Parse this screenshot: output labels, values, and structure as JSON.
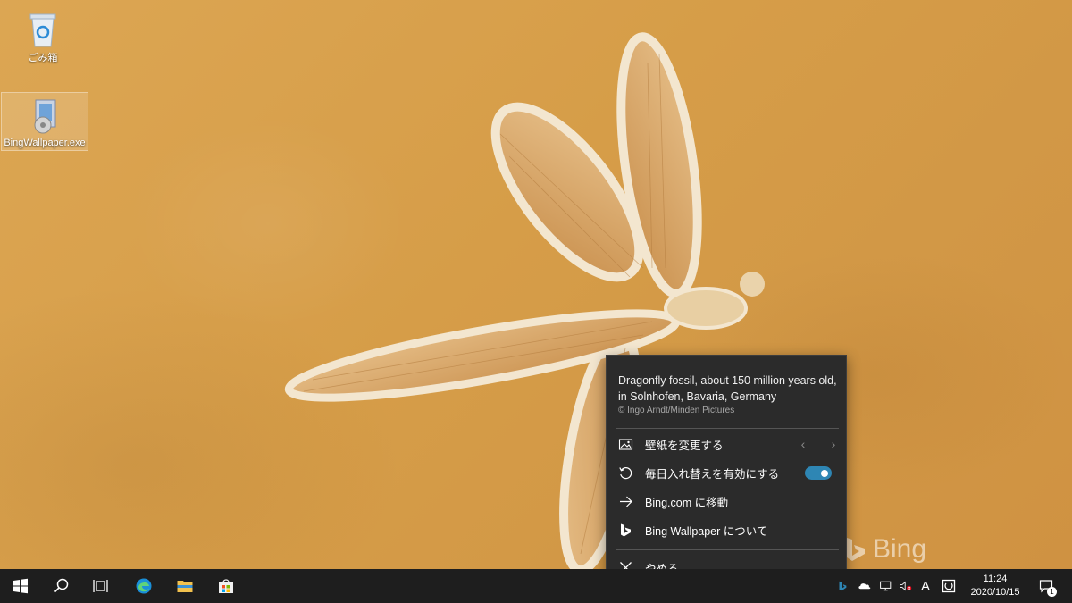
{
  "desktop": {
    "icons": [
      {
        "label": "ごみ箱",
        "icon": "recycle-bin-icon"
      },
      {
        "label": "BingWallpaper.exe",
        "icon": "installer-icon"
      }
    ]
  },
  "watermark": {
    "text": "Bing",
    "icon": "bing-logo-icon"
  },
  "flyout": {
    "description": "Dragonfly fossil, about 150 million years old, in Solnhofen, Bavaria, Germany",
    "credit": "© Ingo Arndt/Minden Pictures",
    "items": [
      {
        "label": "壁紙を変更する",
        "icon": "picture-icon",
        "prev": "‹",
        "next": "›"
      },
      {
        "label": "毎日入れ替えを有効にする",
        "icon": "refresh-icon",
        "toggle_on": true
      },
      {
        "label": "Bing.com に移動",
        "icon": "arrow-right-icon"
      },
      {
        "label": "Bing Wallpaper について",
        "icon": "bing-icon"
      },
      {
        "label": "やめる",
        "icon": "close-icon"
      }
    ],
    "accent": "#2e86b4"
  },
  "taskbar": {
    "apps": [
      "start-icon",
      "search-icon",
      "task-view-icon",
      "edge-icon",
      "file-explorer-icon",
      "store-icon"
    ],
    "tray": {
      "ime": "A",
      "time": "11:24",
      "date": "2020/10/15",
      "notification_count": "1"
    }
  }
}
